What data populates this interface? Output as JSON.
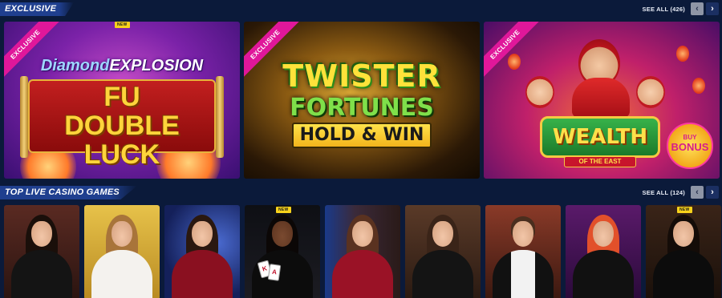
{
  "sections": {
    "exclusive": {
      "title": "EXCLUSIVE",
      "see_all": "SEE ALL (426)",
      "prev_icon": "chevron-left-icon",
      "next_icon": "chevron-right-icon",
      "tiles": [
        {
          "badge_new": "NEW",
          "ribbon": "EXCLUSIVE",
          "title_top_a": "Diamond",
          "title_top_b": "EXPLOSION",
          "title_main": "FU DOUBLE LUCK"
        },
        {
          "ribbon": "EXCLUSIVE",
          "title_line1": "TWISTER",
          "title_line2": "FORTUNES",
          "title_line3": "HOLD & WIN"
        },
        {
          "ribbon": "EXCLUSIVE",
          "title_main": "WEALTH",
          "title_sub": "OF THE EAST",
          "buy_line1": "BUY",
          "buy_line2": "BONUS"
        }
      ]
    },
    "live_casino": {
      "title": "TOP LIVE CASINO GAMES",
      "see_all": "SEE ALL (124)",
      "prev_icon": "chevron-left-icon",
      "next_icon": "chevron-right-icon",
      "badge_new": "NEW",
      "card_k": "K",
      "card_a": "A"
    }
  },
  "colors": {
    "page_bg": "#0b1a3a",
    "section_title_bg": "#1f3f8f",
    "exclusive_ribbon": "#e0179a",
    "new_badge": "#f7d21b"
  }
}
